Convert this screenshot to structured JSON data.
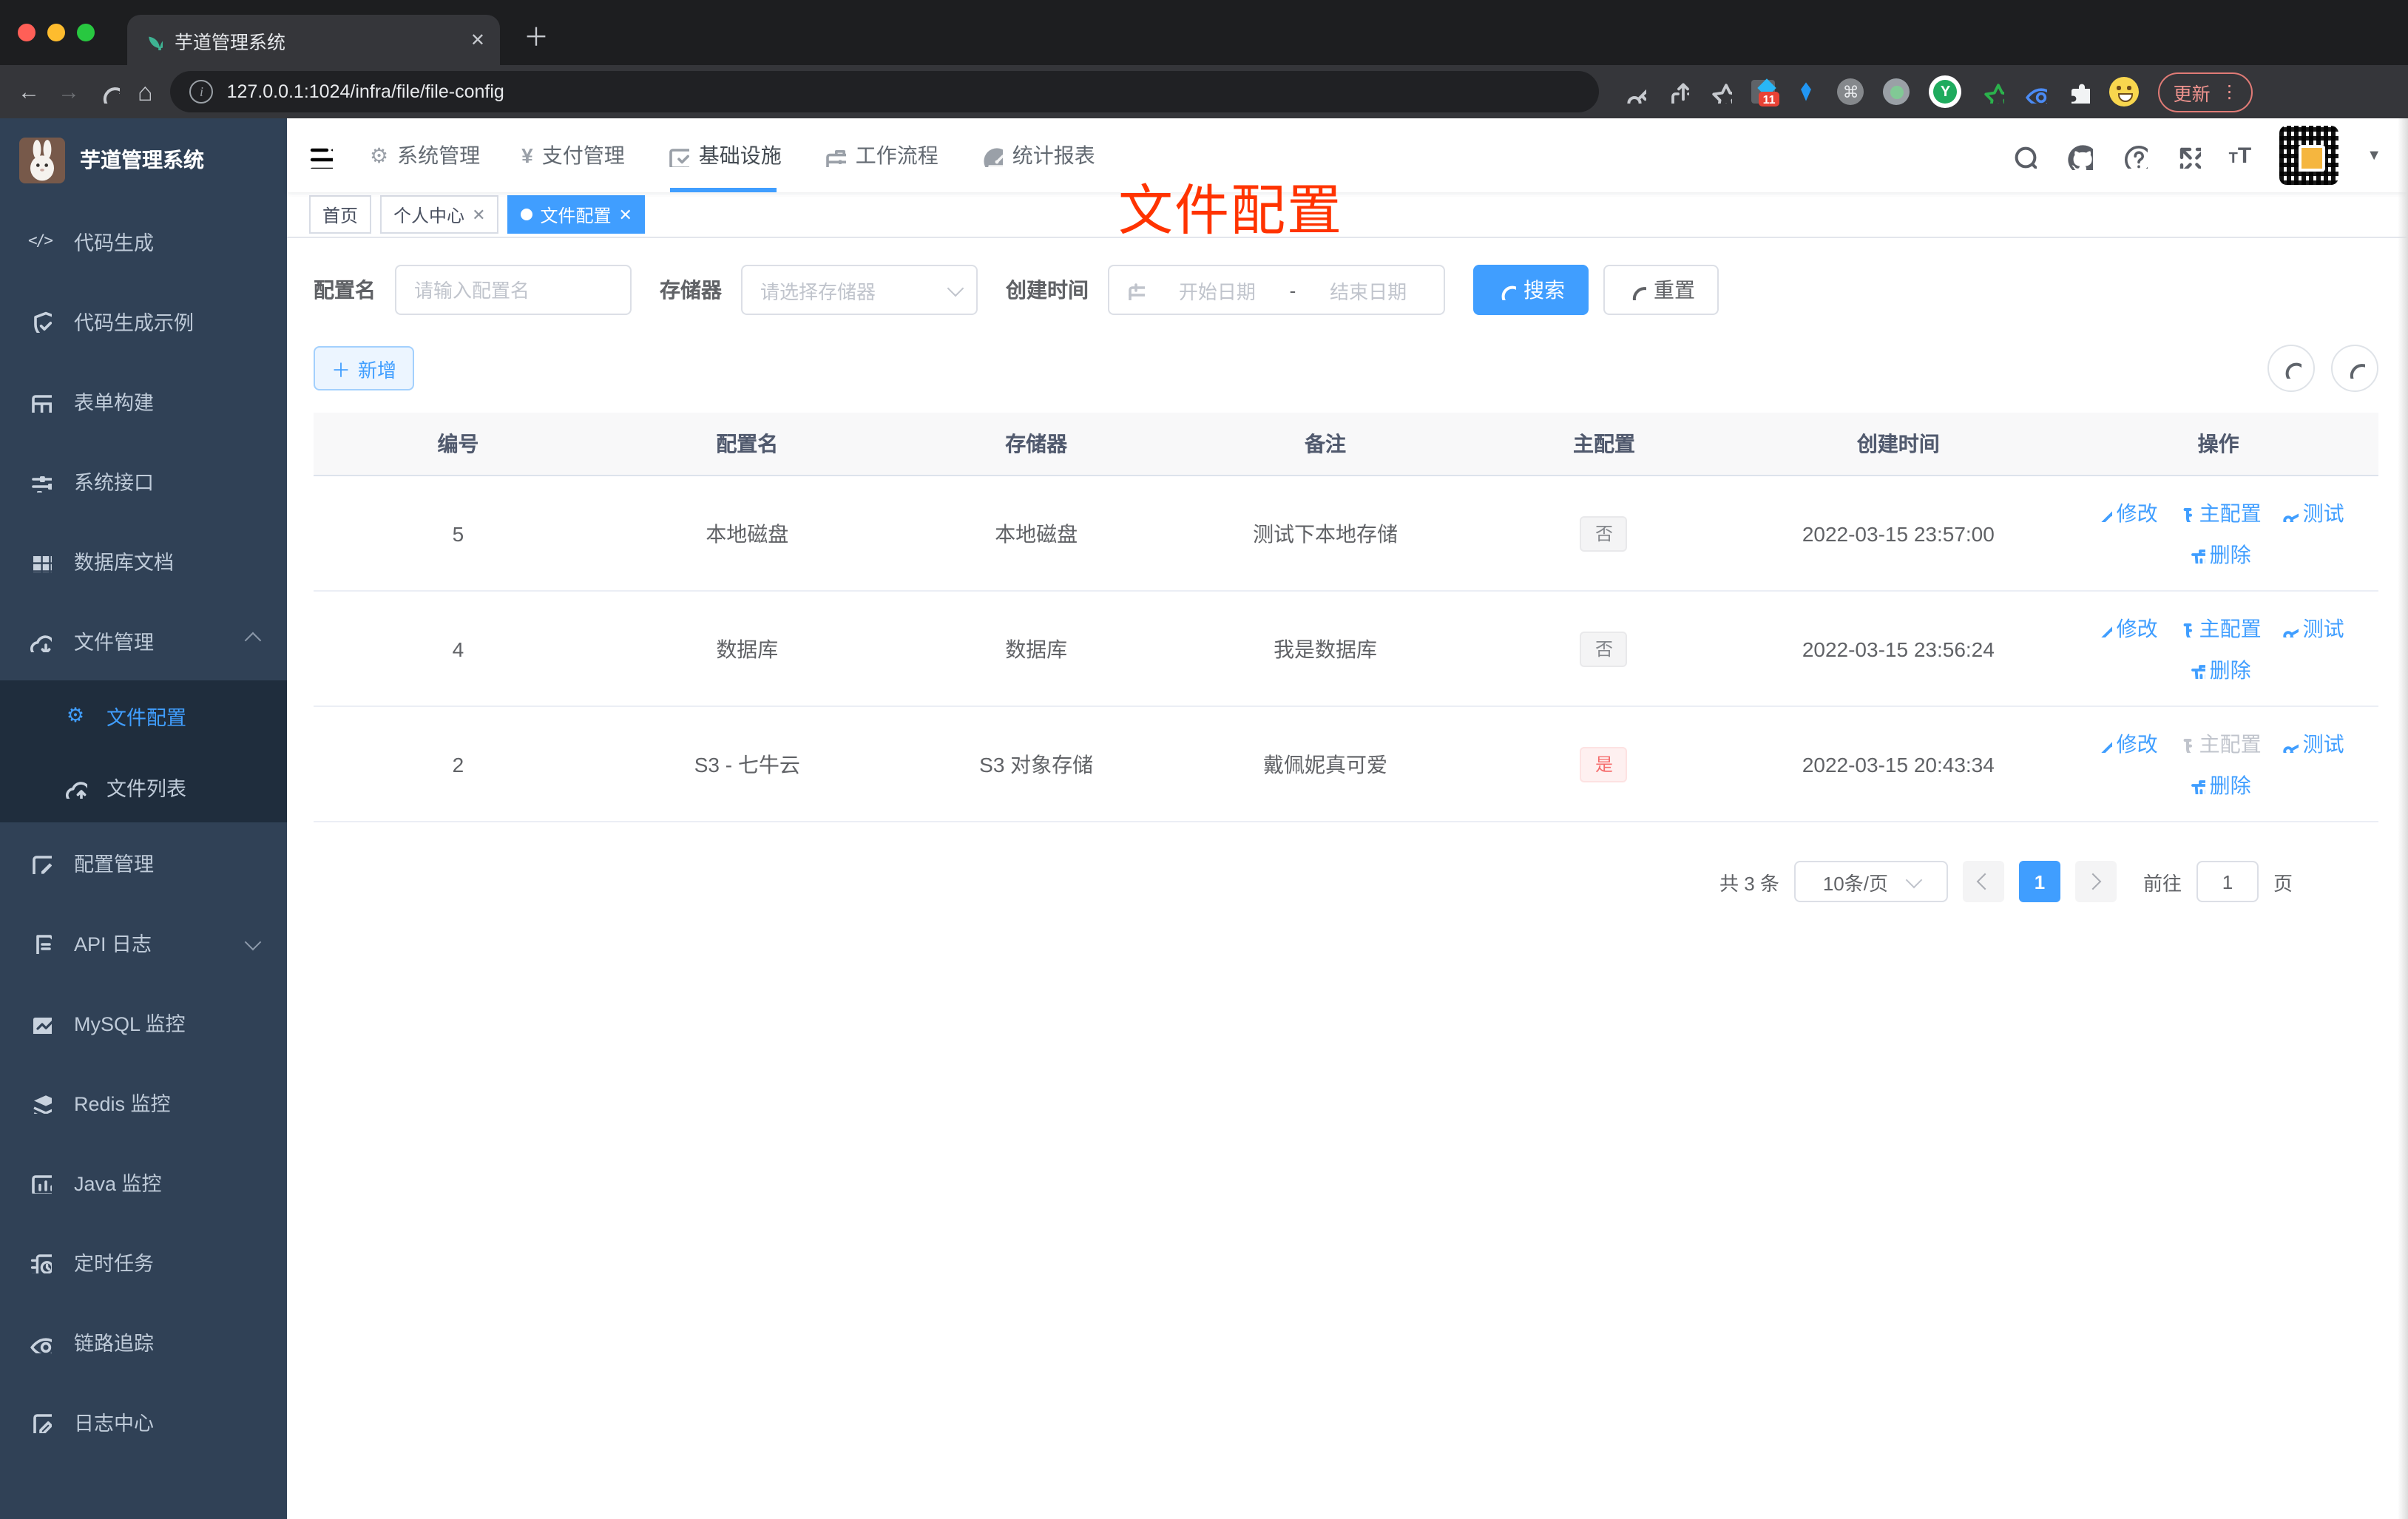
{
  "browser": {
    "tab_title": "芋道管理系统",
    "url": "127.0.0.1:1024/infra/file/file-config",
    "update_label": "更新",
    "extension_badge": "11"
  },
  "sidebar": {
    "title": "芋道管理系统",
    "items": [
      {
        "label": "代码生成",
        "icon": "code-icon"
      },
      {
        "label": "代码生成示例",
        "icon": "shield-check-icon"
      },
      {
        "label": "表单构建",
        "icon": "form-table-icon"
      },
      {
        "label": "系统接口",
        "icon": "sliders-icon"
      },
      {
        "label": "数据库文档",
        "icon": "grid-icon"
      },
      {
        "label": "文件管理",
        "icon": "cloud-download-icon",
        "expanded": true
      },
      {
        "label": "文件配置",
        "icon": "gear-icon",
        "active": true
      },
      {
        "label": "文件列表",
        "icon": "cloud-upload-icon"
      },
      {
        "label": "配置管理",
        "icon": "edit-square-icon"
      },
      {
        "label": "API 日志",
        "icon": "doc-edit-icon",
        "collapsed": true
      },
      {
        "label": "MySQL 监控",
        "icon": "chart-icon"
      },
      {
        "label": "Redis 监控",
        "icon": "layers-icon"
      },
      {
        "label": "Java 监控",
        "icon": "monitor-bars-icon"
      },
      {
        "label": "定时任务",
        "icon": "timer-icon"
      },
      {
        "label": "链路追踪",
        "icon": "eye-icon"
      },
      {
        "label": "日志中心",
        "icon": "log-pen-icon"
      }
    ]
  },
  "nav": {
    "items": [
      {
        "label": "系统管理",
        "icon": "gear-icon"
      },
      {
        "label": "支付管理",
        "icon": "yen-icon"
      },
      {
        "label": "基础设施",
        "icon": "monitor-check-icon",
        "active": true
      },
      {
        "label": "工作流程",
        "icon": "briefcase-icon"
      },
      {
        "label": "统计报表",
        "icon": "gauge-icon"
      }
    ]
  },
  "tags": {
    "items": [
      {
        "label": "首页",
        "closable": false
      },
      {
        "label": "个人中心",
        "closable": true
      },
      {
        "label": "文件配置",
        "closable": true,
        "active": true
      }
    ]
  },
  "annotation": {
    "text": "文件配置",
    "color": "#ff3300"
  },
  "filters": {
    "name_label": "配置名",
    "name_placeholder": "请输入配置名",
    "storage_label": "存储器",
    "storage_placeholder": "请选择存储器",
    "date_label": "创建时间",
    "date_start_placeholder": "开始日期",
    "date_separator": "-",
    "date_end_placeholder": "结束日期",
    "search_label": "搜索",
    "reset_label": "重置"
  },
  "toolbar": {
    "add_label": "新增"
  },
  "table": {
    "headers": [
      "编号",
      "配置名",
      "存储器",
      "备注",
      "主配置",
      "创建时间",
      "操作"
    ],
    "action_labels": {
      "edit": "修改",
      "master": "主配置",
      "test": "测试",
      "delete": "删除"
    },
    "rows": [
      {
        "id": "5",
        "name": "本地磁盘",
        "storage": "本地磁盘",
        "remark": "测试下本地存储",
        "master": "否",
        "master_type": "info",
        "created": "2022-03-15 23:57:00",
        "master_action_disabled": false
      },
      {
        "id": "4",
        "name": "数据库",
        "storage": "数据库",
        "remark": "我是数据库",
        "master": "否",
        "master_type": "info",
        "created": "2022-03-15 23:56:24",
        "master_action_disabled": false
      },
      {
        "id": "2",
        "name": "S3 - 七牛云",
        "storage": "S3 对象存储",
        "remark": "戴佩妮真可爱",
        "master": "是",
        "master_type": "danger",
        "created": "2022-03-15 20:43:34",
        "master_action_disabled": true
      }
    ]
  },
  "pagination": {
    "total": "共 3 条",
    "page_size": "10条/页",
    "current_page": "1",
    "goto_label": "前往",
    "goto_value": "1",
    "page_unit": "页"
  },
  "colors": {
    "accent": "#409eff",
    "danger": "#f56c6c",
    "sidebar_bg": "#304156",
    "submenu_bg": "#1f2d3d",
    "annotation_red": "#ff3300",
    "primary_tag_bg": "#ecf5ff"
  },
  "icons": {
    "search": "magnifier",
    "github": "octocat",
    "help": "question-circle",
    "fullscreen": "expand-arrows",
    "font_size": "TT",
    "refresh": "circular-arrow",
    "edit": "pen",
    "master": "magnet",
    "test": "share-nodes",
    "delete": "trash",
    "calendar": "calendar",
    "add": "plus"
  }
}
